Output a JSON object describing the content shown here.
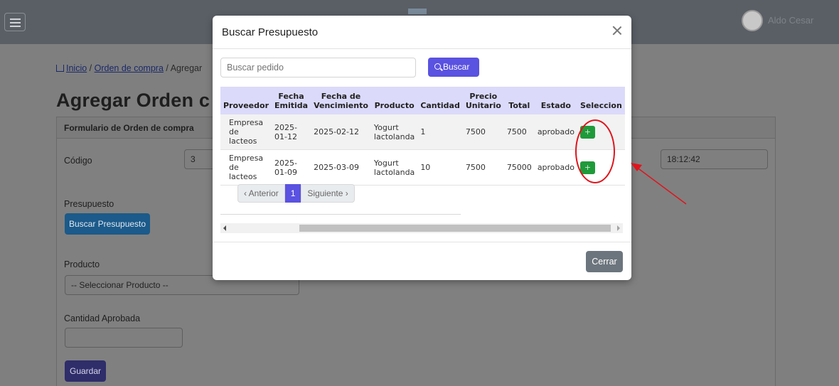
{
  "background": {
    "user_name": "Aldo Cesar",
    "breadcrumb": {
      "home": "Inicio",
      "separator1": "/",
      "orden": "Orden de compra",
      "separator2": "/",
      "current": "Agregar"
    },
    "page_title": "Agregar Orden c",
    "card_header": "Formulario de Orden de compra",
    "codigo_label": "Código",
    "codigo_value": "3",
    "time_value": "18:12:42",
    "presupuesto_label": "Presupuesto",
    "buscar_presupuesto_button": "Buscar Presupuesto",
    "producto_label": "Producto",
    "producto_select": "-- Seleccionar Producto --",
    "cantidad_label": "Cantidad Aprobada",
    "guardar_button": "Guardar"
  },
  "modal": {
    "title": "Buscar Presupuesto",
    "search_placeholder": "Buscar pedido",
    "search_button": "Buscar",
    "columns": {
      "proveedor": "Proveedor",
      "fecha_emitida_1": "Fecha",
      "fecha_emitida_2": "Emitida",
      "fecha_venc_1": "Fecha de",
      "fecha_venc_2": "Vencimiento",
      "producto": "Producto",
      "cantidad": "Cantidad",
      "precio_1": "Precio",
      "precio_2": "Unitario",
      "total": "Total",
      "estado": "Estado",
      "seleccion": "Seleccion"
    },
    "rows": [
      {
        "proveedor_1": "Empresa",
        "proveedor_2": "de lacteos",
        "emitida_1": "2025-",
        "emitida_2": "01-12",
        "vencimiento": "2025-02-12",
        "producto_1": "Yogurt",
        "producto_2": "lactolanda",
        "cantidad": "1",
        "precio": "7500",
        "total": "7500",
        "estado": "aprobado",
        "select": "+"
      },
      {
        "proveedor_1": "Empresa",
        "proveedor_2": "de lacteos",
        "emitida_1": "2025-",
        "emitida_2": "01-09",
        "vencimiento": "2025-03-09",
        "producto_1": "Yogurt",
        "producto_2": "lactolanda",
        "cantidad": "10",
        "precio": "7500",
        "total": "75000",
        "estado": "aprobado",
        "select": "+"
      }
    ],
    "pagination": {
      "prev": "‹ Anterior",
      "current": "1",
      "next": "Siguiente ›"
    },
    "close_button": "Cerrar"
  },
  "colors": {
    "primary": "#5a52e0",
    "success": "#1f9a3a",
    "secondary": "#6c757d",
    "annotation": "#e0141c"
  }
}
